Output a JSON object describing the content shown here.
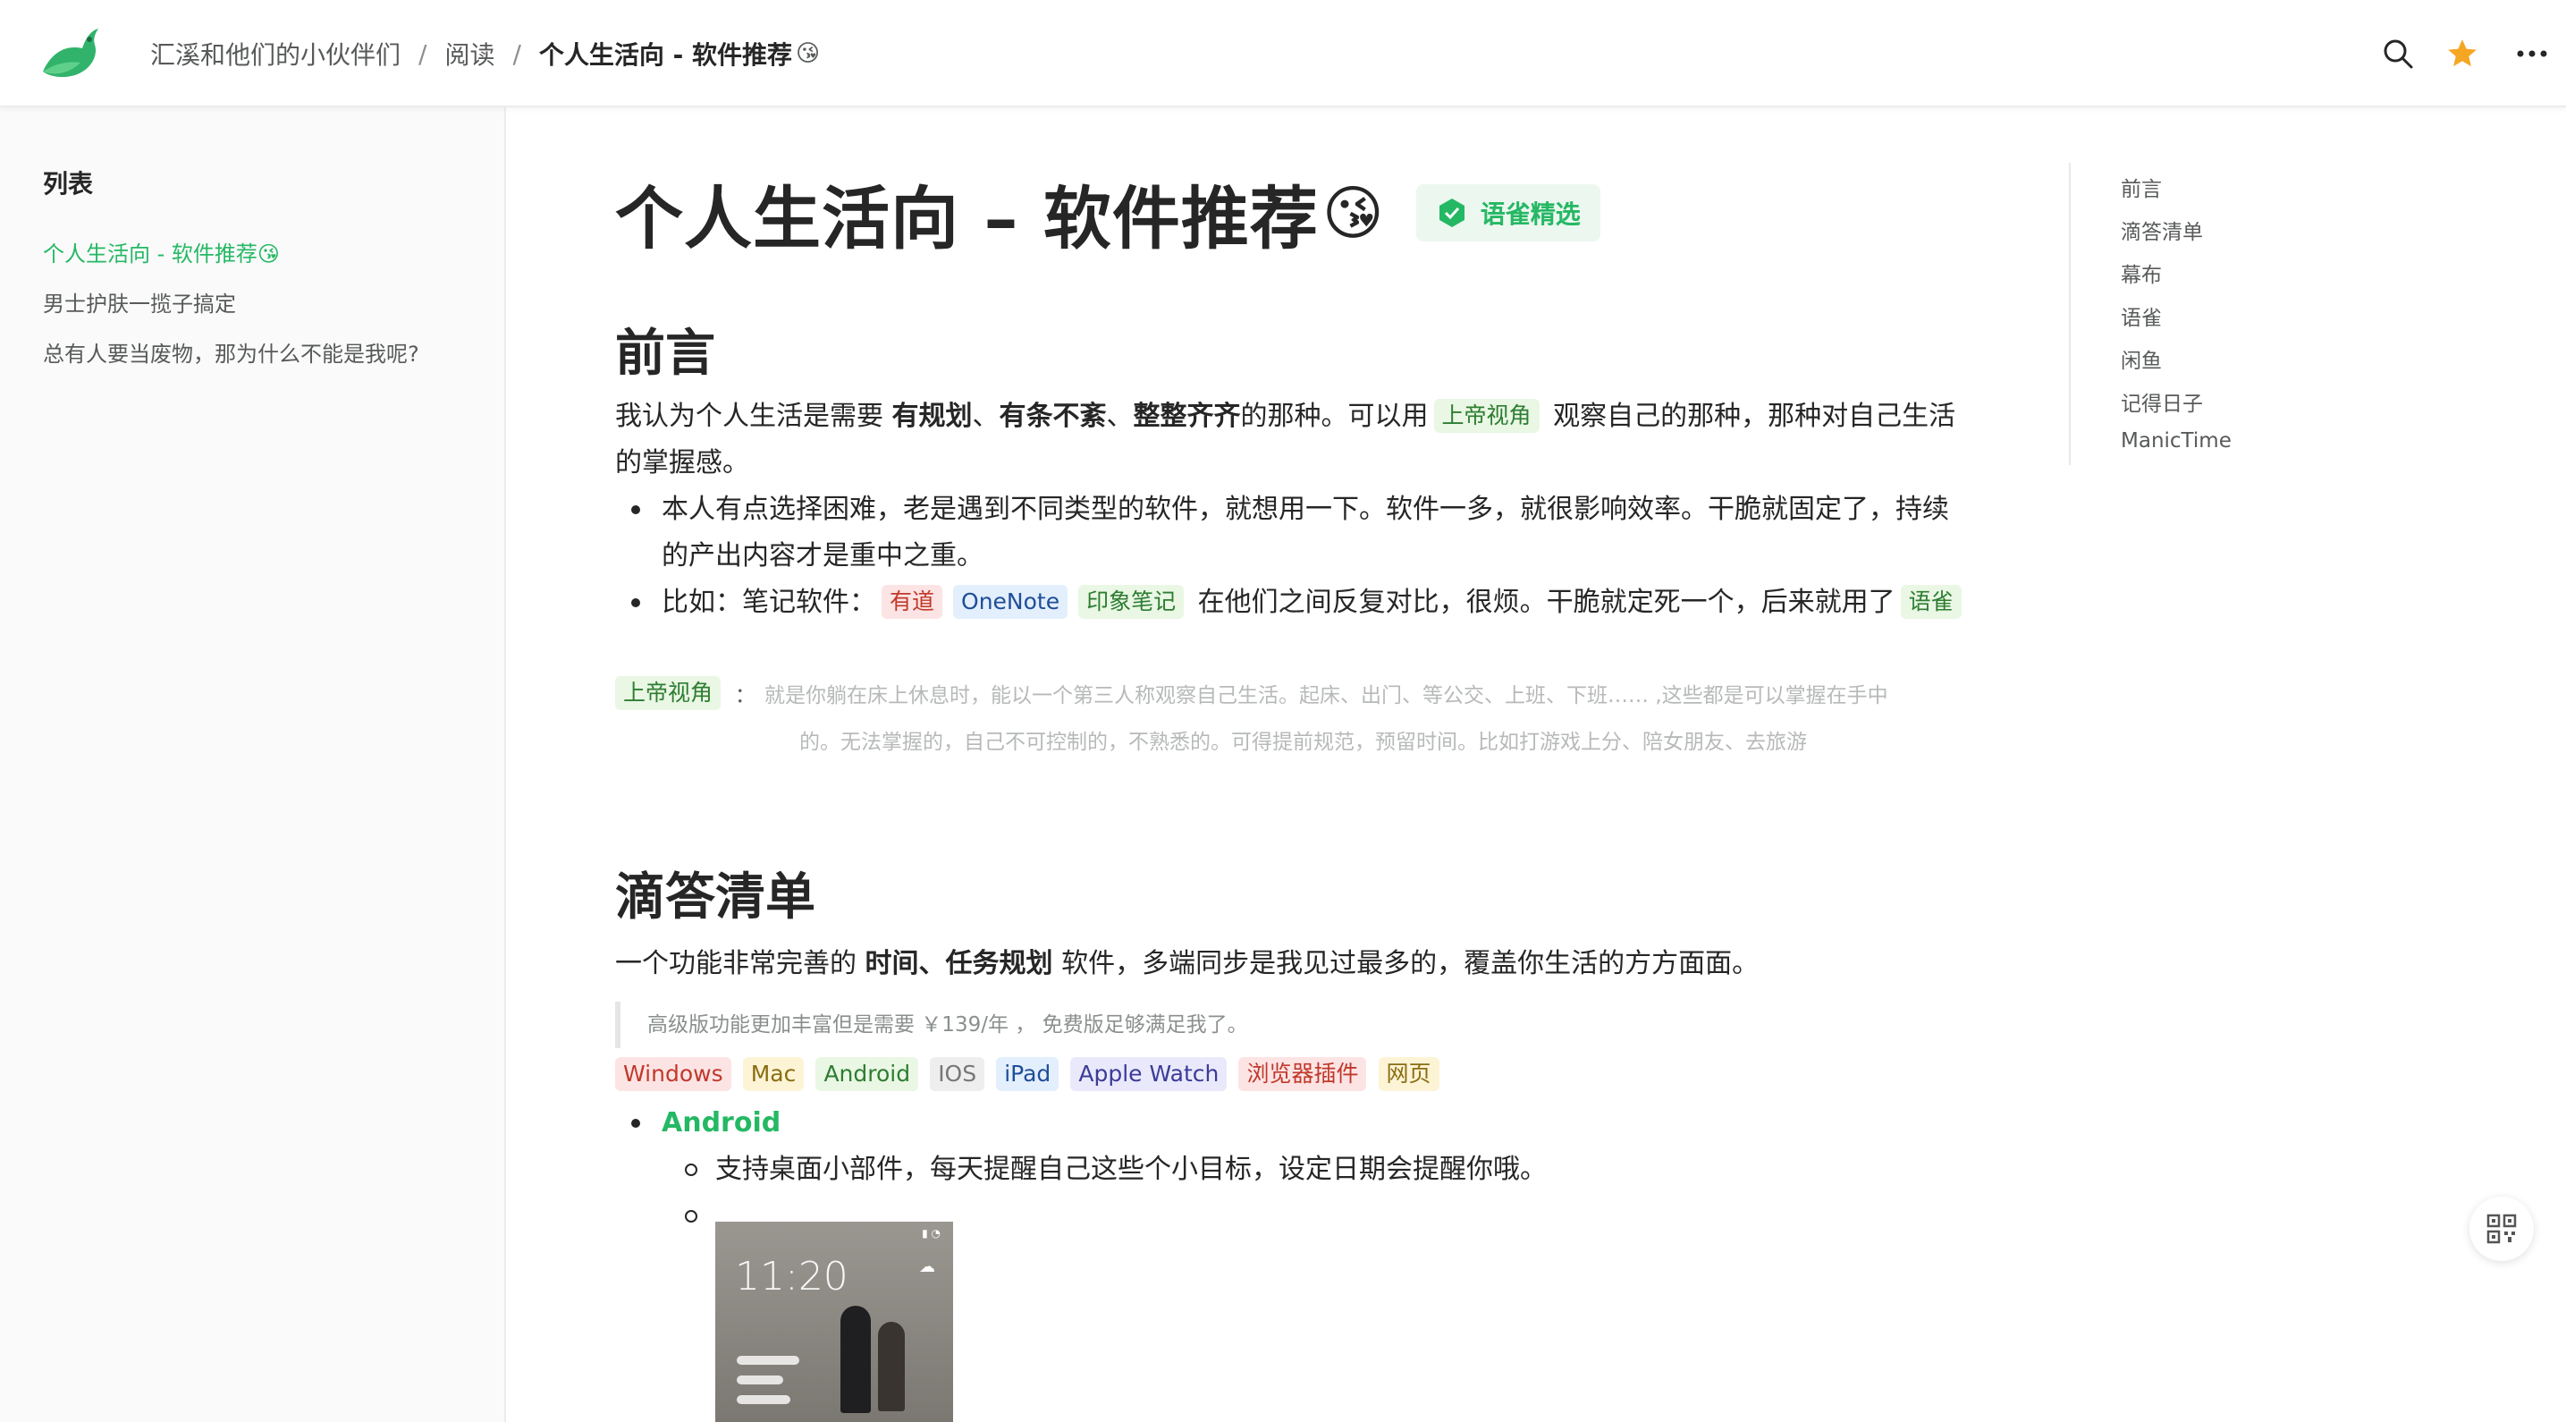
{
  "header": {
    "breadcrumbs": [
      "汇溪和他们的小伙伴们",
      "阅读",
      "个人生活向 - 软件推荐"
    ],
    "breadcrumb_emoji": "😘",
    "icons": [
      "search-icon",
      "star-icon",
      "more-icon"
    ],
    "colors": {
      "star": "#f5a623",
      "logo": "#31b36b"
    }
  },
  "sidebar": {
    "title": "列表",
    "items": [
      {
        "label": "个人生活向 - 软件推荐😘",
        "active": true
      },
      {
        "label": "男士护肤一揽子搞定",
        "active": false
      },
      {
        "label": "总有人要当废物，那为什么不能是我呢?",
        "active": false
      }
    ]
  },
  "article": {
    "title": "个人生活向 – 软件推荐",
    "title_emoji": "😘",
    "badge": "语雀精选",
    "sections": {
      "preface": {
        "heading": "前言",
        "p1_a": "我认为个人生活是需要 ",
        "p1_b1": "有规划",
        "p1_sep1": "、",
        "p1_b2": "有条不紊",
        "p1_sep2": "、",
        "p1_b3": "整整齐齐",
        "p1_c": "的那种。可以用",
        "p1_tag": "上帝视角",
        "p1_d": " 观察自己的那种，那种对自己生活的掌握感。",
        "bullet1": "本人有点选择困难，老是遇到不同类型的软件，就想用一下。软件一多，就很影响效率。干脆就固定了，持续的产出内容才是重中之重。",
        "bullet2_a": "比如：笔记软件：",
        "bullet2_tags": [
          "有道",
          "OneNote",
          "印象笔记"
        ],
        "bullet2_b": " 在他们之间反复对比，很烦。干脆就定死一个，后来就用了",
        "bullet2_tag_end": "语雀",
        "note_tag": "上帝视角",
        "note_colon": "：",
        "note_line1": "就是你躺在床上休息时，能以一个第三人称观察自己生活。起床、出门、等公交、上班、下班……   ,这些都是可以掌握在手中",
        "note_line2": "的。无法掌握的，自己不可控制的，不熟悉的。可得提前规范，预留时间。比如打游戏上分、陪女朋友、去旅游"
      },
      "ticktick": {
        "heading": "滴答清单",
        "p_a": "一个功能非常完善的 ",
        "p_b": "时间、任务规划",
        "p_c": " 软件，多端同步是我见过最多的，覆盖你生活的方方面面。",
        "quote": "高级版功能更加丰富但是需要 ￥139/年 ， 免费版足够满足我了。",
        "platform_tags": [
          {
            "label": "Windows",
            "color": "red"
          },
          {
            "label": "Mac",
            "color": "yellow"
          },
          {
            "label": "Android",
            "color": "green"
          },
          {
            "label": "IOS",
            "color": "grey"
          },
          {
            "label": "iPad",
            "color": "blue"
          },
          {
            "label": "Apple Watch",
            "color": "purple"
          },
          {
            "label": "浏览器插件",
            "color": "red"
          },
          {
            "label": "网页",
            "color": "yellow"
          }
        ],
        "android_label": "Android",
        "android_sub1": "支持桌面小部件，每天提醒自己这些个小目标，设定日期会提醒你哦。",
        "phone_time": "11:20"
      }
    }
  },
  "toc": {
    "items": [
      "前言",
      "滴答清单",
      "幕布",
      "语雀",
      "闲鱼",
      "记得日子",
      "ManicTime"
    ]
  }
}
